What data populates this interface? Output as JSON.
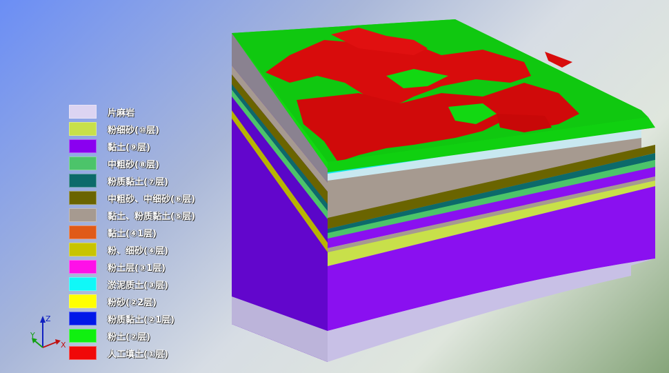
{
  "legend": {
    "items": [
      {
        "label": "片麻岩",
        "color": "#dcd4f2"
      },
      {
        "label": "粉细砂(⑩层)",
        "color": "#c8e04a"
      },
      {
        "label": "黏土(⑨层)",
        "color": "#8a00f0"
      },
      {
        "label": "中粗砂(⑧层)",
        "color": "#4cc46a"
      },
      {
        "label": "粉质黏土(⑦层)",
        "color": "#0c6a6a"
      },
      {
        "label": "中粗砂、中细砂(⑥层)",
        "color": "#6a6400"
      },
      {
        "label": "黏土、粉质黏土(⑤层)",
        "color": "#a69a90"
      },
      {
        "label": "黏土(④1层)",
        "color": "#e05a18"
      },
      {
        "label": "粉、细砂(④层)",
        "color": "#c8c400"
      },
      {
        "label": "粉土层(③1层)",
        "color": "#ff10e8"
      },
      {
        "label": "淤泥质土(③层)",
        "color": "#10f8f8"
      },
      {
        "label": "粉砂(②2层)",
        "color": "#ffff00"
      },
      {
        "label": "粉质黏土(②1层)",
        "color": "#0018e8"
      },
      {
        "label": "粉土(②层)",
        "color": "#10f010"
      },
      {
        "label": "人工填土(①层)",
        "color": "#f00808"
      }
    ]
  },
  "axes": {
    "z": "Z",
    "y": "Y",
    "x": "X"
  },
  "colors": {
    "top_green": "#12d812",
    "top_red": "#d80c0c",
    "left_face_purple": "#6a08d6",
    "front_face_purple": "#8a10f0",
    "gneiss": "#c8c0e6",
    "clay_silt": "#a89c90"
  }
}
